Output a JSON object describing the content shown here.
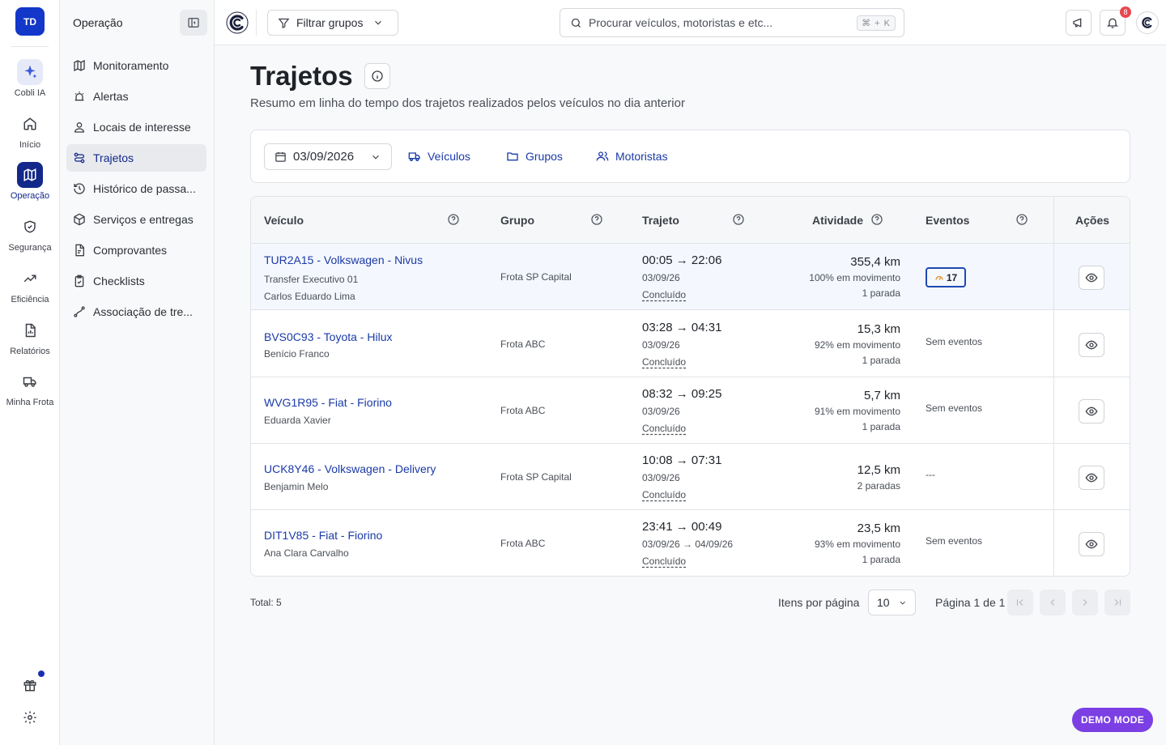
{
  "user": {
    "initials": "TD"
  },
  "rail": {
    "items": [
      {
        "label": "Cobli IA"
      },
      {
        "label": "Início"
      },
      {
        "label": "Operação"
      },
      {
        "label": "Segurança"
      },
      {
        "label": "Eficiência"
      },
      {
        "label": "Relatórios"
      },
      {
        "label": "Minha Frota"
      }
    ]
  },
  "sidebar": {
    "title": "Operação",
    "items": [
      {
        "label": "Monitoramento"
      },
      {
        "label": "Alertas"
      },
      {
        "label": "Locais de interesse"
      },
      {
        "label": "Trajetos"
      },
      {
        "label": "Histórico de passa..."
      },
      {
        "label": "Serviços e entregas"
      },
      {
        "label": "Comprovantes"
      },
      {
        "label": "Checklists"
      },
      {
        "label": "Associação de tre..."
      }
    ]
  },
  "topbar": {
    "filter_label": "Filtrar grupos",
    "search_placeholder": "Procurar veículos, motoristas e etc...",
    "shortcut": "⌘ + K",
    "notifications_count": "8"
  },
  "page": {
    "title": "Trajetos",
    "subtitle": "Resumo em linha do tempo dos trajetos realizados pelos veículos no dia anterior"
  },
  "filters": {
    "date": "03/09/2026",
    "tabs": [
      {
        "label": "Veículos"
      },
      {
        "label": "Grupos"
      },
      {
        "label": "Motoristas"
      }
    ]
  },
  "table": {
    "headers": {
      "vehicle": "Veículo",
      "group": "Grupo",
      "route": "Trajeto",
      "activity": "Atividade",
      "events": "Eventos",
      "actions": "Ações"
    },
    "rows": [
      {
        "vehicle": "TUR2A15 - Volkswagen - Nivus",
        "sub1": "Transfer Executivo 01",
        "sub2": "Carlos Eduardo Lima",
        "group": "Frota SP Capital",
        "time": "00:05 → 22:06",
        "date": "03/09/26",
        "status": "Concluído",
        "km": "355,4 km",
        "movement": "100% em movimento",
        "stops": "1 parada",
        "events": "17"
      },
      {
        "vehicle": "BVS0C93 - Toyota - Hilux",
        "sub1": "Benício Franco",
        "group": "Frota ABC",
        "time": "03:28 → 04:31",
        "date": "03/09/26",
        "status": "Concluído",
        "km": "15,3 km",
        "movement": "92% em movimento",
        "stops": "1 parada",
        "events": "Sem eventos"
      },
      {
        "vehicle": "WVG1R95 - Fiat - Fiorino",
        "sub1": "Eduarda Xavier",
        "group": "Frota ABC",
        "time": "08:32 → 09:25",
        "date": "03/09/26",
        "status": "Concluído",
        "km": "5,7 km",
        "movement": "91% em movimento",
        "stops": "1 parada",
        "events": "Sem eventos"
      },
      {
        "vehicle": "UCK8Y46 - Volkswagen - Delivery",
        "sub1": "Benjamin Melo",
        "group": "Frota SP Capital",
        "time": "10:08 → 07:31",
        "date": "03/09/26",
        "status": "Concluído",
        "km": "12,5 km",
        "stops": "2 paradas",
        "events": "---"
      },
      {
        "vehicle": "DIT1V85 - Fiat - Fiorino",
        "sub1": "Ana Clara Carvalho",
        "group": "Frota ABC",
        "time": "23:41 → 00:49",
        "date": "03/09/26 → 04/09/26",
        "status": "Concluído",
        "km": "23,5 km",
        "movement": "93% em movimento",
        "stops": "1 parada",
        "events": "Sem eventos"
      }
    ]
  },
  "pagination": {
    "total": "Total: 5",
    "items_per_page_label": "Itens por página",
    "items_per_page": "10",
    "page_info": "Página 1 de 1"
  },
  "demo_label": "DEMO MODE",
  "colors": {
    "primary": "#1237c9",
    "active": "#13288a",
    "link": "#1a3aa8",
    "demo": "#7b3fe4",
    "badge": "#e5484d"
  }
}
